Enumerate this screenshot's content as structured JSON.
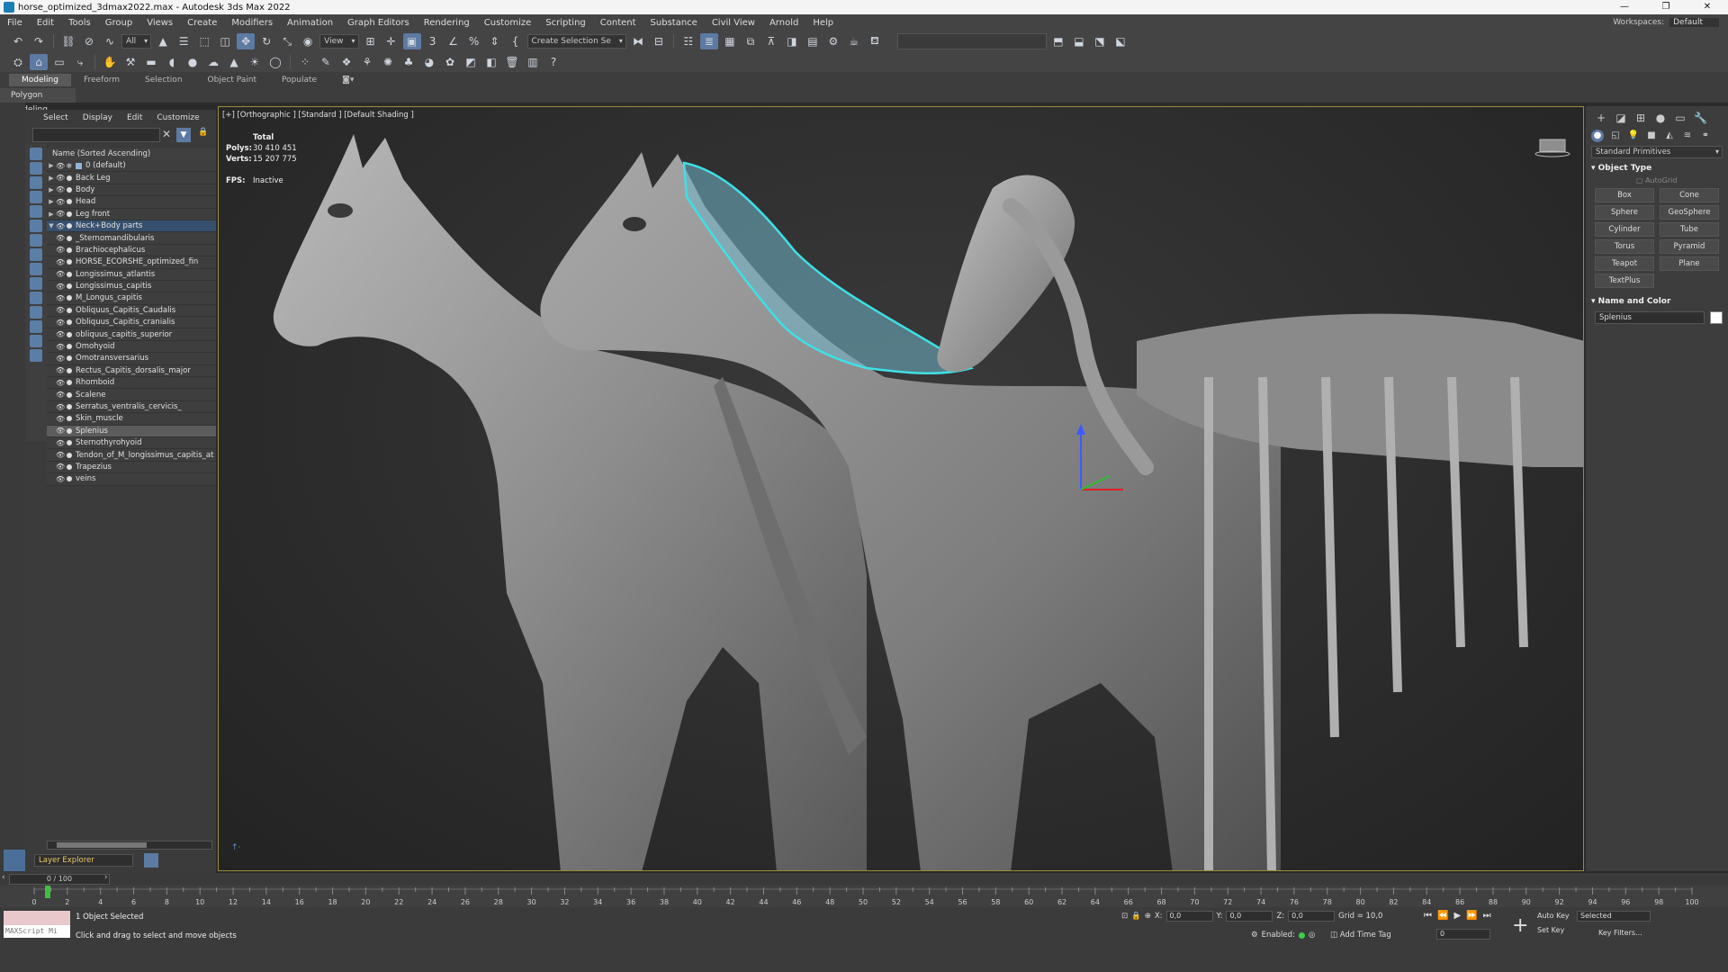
{
  "window": {
    "title": "horse_optimized_3dmax2022.max - Autodesk 3ds Max 2022",
    "controls": [
      "—",
      "❐",
      "✕"
    ]
  },
  "menu": {
    "items": [
      "File",
      "Edit",
      "Tools",
      "Group",
      "Views",
      "Create",
      "Modifiers",
      "Animation",
      "Graph Editors",
      "Rendering",
      "Customize",
      "Scripting",
      "Content",
      "Substance",
      "Civil View",
      "Arnold",
      "Help"
    ],
    "workspace_label": "Workspaces:",
    "workspace_value": "Default"
  },
  "toolbar": {
    "selection_filter": "All",
    "reference_coord": "View",
    "named_selection": "Create Selection Se"
  },
  "ribbon": {
    "tabs": [
      "Modeling",
      "Freeform",
      "Selection",
      "Object Paint",
      "Populate"
    ],
    "active_tab": "Modeling",
    "sub_label": "Polygon Modeling"
  },
  "scene_explorer": {
    "menu": [
      "Select",
      "Display",
      "Edit",
      "Customize"
    ],
    "column_header": "Name (Sorted Ascending)",
    "layers": [
      "0 (default)",
      "Back Leg",
      "Body",
      "Head",
      "Leg front",
      "Neck+Body parts"
    ],
    "objects": [
      "_Sternomandibularis",
      "Brachiocephalicus",
      "HORSE_ECORSHE_optimized_fin",
      "Longissimus_atlantis",
      "Longissimus_capitis",
      "M_Longus_capitis",
      "Obliquus_Capitis_Caudalis",
      "Obliquus_Capitis_cranialis",
      "obliquus_capitis_superior",
      "Omohyoid",
      "Omotransversarius",
      "Rectus_Capitis_dorsalis_major",
      "Rhomboid",
      "Scalene",
      "Serratus_ventralis_cervicis_",
      "Skin_muscle",
      "Splenius",
      "Sternothyrohyoid",
      "Tendon_of_M_longissimus_capitis_at",
      "Trapezius",
      "veins"
    ],
    "selected_layer": "Neck+Body parts",
    "highlighted_object": "Splenius",
    "footer_label": "Layer Explorer"
  },
  "viewport": {
    "label": "[+] [Orthographic ] [Standard ] [Default Shading ]",
    "stats_title": "Total",
    "polys_label": "Polys:",
    "polys_value": "30 410 451",
    "verts_label": "Verts:",
    "verts_value": "15 207 775",
    "fps_label": "FPS:",
    "fps_value": "Inactive"
  },
  "command_panel": {
    "category": "Standard Primitives",
    "object_type_title": "Object Type",
    "autogrid": "AutoGrid",
    "buttons": [
      "Box",
      "Cone",
      "Sphere",
      "GeoSphere",
      "Cylinder",
      "Tube",
      "Torus",
      "Pyramid",
      "Teapot",
      "Plane",
      "TextPlus"
    ],
    "name_color_title": "Name and Color",
    "object_name": "Splenius",
    "object_color": "#ffffff"
  },
  "timeline": {
    "slider_label": "0 / 100",
    "ticks": [
      "0",
      "2",
      "4",
      "6",
      "8",
      "10",
      "12",
      "14",
      "16",
      "18",
      "20",
      "22",
      "24",
      "26",
      "28",
      "30",
      "32",
      "34",
      "36",
      "38",
      "40",
      "42",
      "44",
      "46",
      "48",
      "50",
      "52",
      "54",
      "56",
      "58",
      "60",
      "62",
      "64",
      "66",
      "68",
      "70",
      "72",
      "74",
      "76",
      "78",
      "80",
      "82",
      "84",
      "86",
      "88",
      "90",
      "92",
      "94",
      "96",
      "98",
      "100"
    ]
  },
  "status": {
    "maxscript_placeholder": "MAXScript Mi",
    "selection_text": "1 Object Selected",
    "prompt_text": "Click and drag to select and move objects",
    "x_label": "X:",
    "x_value": "0,0",
    "y_label": "Y:",
    "y_value": "0,0",
    "z_label": "Z:",
    "z_value": "0,0",
    "grid_text": "Grid = 10,0",
    "enabled_label": "Enabled:",
    "add_time_tag": "Add Time Tag",
    "frame_value": "0",
    "auto_key": "Auto Key",
    "set_key": "Set Key",
    "key_mode": "Selected",
    "key_filters": "Key Filters..."
  },
  "colors": {
    "accent": "#5d7aa2",
    "selection_outline": "#3fe0e6",
    "viewport_border": "#9a8c3a"
  }
}
